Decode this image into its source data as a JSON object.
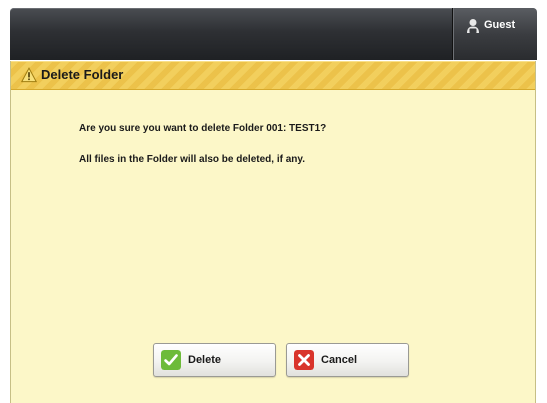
{
  "header": {
    "user_label": "Guest",
    "user_icon": "user-lock-icon"
  },
  "dialog": {
    "title": "Delete Folder",
    "title_icon": "warning-icon",
    "message_primary": "Are you sure you want to delete Folder 001: TEST1?",
    "message_secondary": "All files in the Folder will also be deleted, if any.",
    "buttons": {
      "delete_label": "Delete",
      "delete_icon": "check-icon",
      "cancel_label": "Cancel",
      "cancel_icon": "x-icon"
    }
  },
  "colors": {
    "panel_background": "#fcf7c8",
    "title_bar": "#f2cf5d",
    "topbar": "#2e3034",
    "check_green": "#6dbb3a",
    "cancel_red": "#d9342b"
  }
}
